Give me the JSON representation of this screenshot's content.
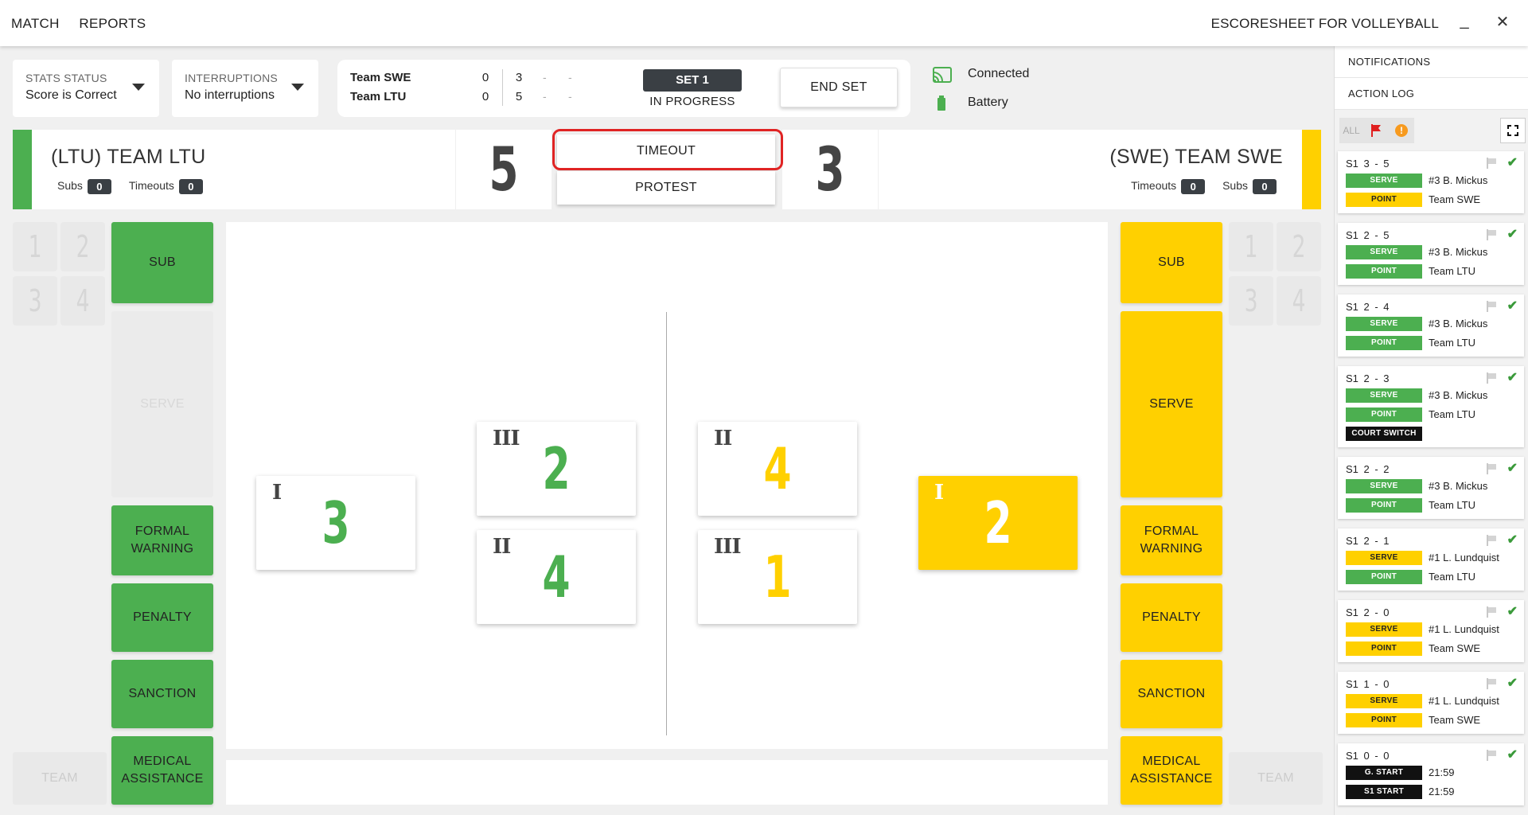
{
  "topbar": {
    "nav": [
      "MATCH",
      "REPORTS"
    ],
    "app_title": "ESCORESHEET FOR VOLLEYBALL",
    "minimize": "_",
    "close": "✕"
  },
  "status": {
    "stats_label": "STATS STATUS",
    "stats_value": "Score is Correct",
    "interruptions_label": "INTERRUPTIONS",
    "interruptions_value": "No interruptions"
  },
  "scoreboard": {
    "teams": [
      {
        "name": "Team SWE",
        "sets": "0",
        "s1": "3",
        "s2": "-",
        "s3": "-"
      },
      {
        "name": "Team LTU",
        "sets": "0",
        "s1": "5",
        "s2": "-",
        "s3": "-"
      }
    ],
    "set_label": "SET 1",
    "set_state": "IN PROGRESS",
    "end_set": "END SET"
  },
  "connection": {
    "connected": "Connected",
    "battery": "Battery",
    "connected_color": "#4caf50",
    "battery_color": "#4caf50"
  },
  "home": {
    "name": "(LTU) TEAM LTU",
    "subs_label": "Subs",
    "subs": "0",
    "timeouts_label": "Timeouts",
    "timeouts": "0",
    "score": "5",
    "color": "#4caf50"
  },
  "away": {
    "name": "(SWE) TEAM SWE",
    "subs_label": "Subs",
    "subs": "0",
    "timeouts_label": "Timeouts",
    "timeouts": "0",
    "score": "3",
    "color": "#ffd000"
  },
  "center": {
    "timeout": "TIMEOUT",
    "protest": "PROTEST"
  },
  "actions": {
    "sub": "SUB",
    "serve": "SERVE",
    "formal_warning_1": "FORMAL",
    "formal_warning_2": "WARNING",
    "penalty": "PENALTY",
    "sanction": "SANCTION",
    "medical_1": "MEDICAL",
    "medical_2": "ASSISTANCE",
    "team": "TEAM"
  },
  "slots": [
    "1",
    "2",
    "3",
    "4"
  ],
  "court": {
    "home": [
      {
        "pos": "I",
        "num": "3"
      },
      {
        "pos": "III",
        "num": "2"
      },
      {
        "pos": "II",
        "num": "4"
      }
    ],
    "away": [
      {
        "pos": "II",
        "num": "4"
      },
      {
        "pos": "III",
        "num": "1"
      },
      {
        "pos": "I",
        "num": "2"
      }
    ]
  },
  "panel": {
    "notifications": "NOTIFICATIONS",
    "action_log": "ACTION LOG",
    "filter_all": "ALL",
    "warning_glyph": "!"
  },
  "log": [
    {
      "head": "S1 3 - 5",
      "rows": [
        {
          "tag": "SERVE",
          "c": "green",
          "t": "#3 B. Mickus"
        },
        {
          "tag": "POINT",
          "c": "yellow",
          "t": "Team SWE"
        }
      ]
    },
    {
      "head": "S1 2 - 5",
      "rows": [
        {
          "tag": "SERVE",
          "c": "green",
          "t": "#3 B. Mickus"
        },
        {
          "tag": "POINT",
          "c": "green",
          "t": "Team LTU"
        }
      ]
    },
    {
      "head": "S1 2 - 4",
      "rows": [
        {
          "tag": "SERVE",
          "c": "green",
          "t": "#3 B. Mickus"
        },
        {
          "tag": "POINT",
          "c": "green",
          "t": "Team LTU"
        }
      ]
    },
    {
      "head": "S1 2 - 3",
      "rows": [
        {
          "tag": "SERVE",
          "c": "green",
          "t": "#3 B. Mickus"
        },
        {
          "tag": "POINT",
          "c": "green",
          "t": "Team LTU"
        },
        {
          "tag": "COURT SWITCH",
          "c": "black",
          "t": ""
        }
      ]
    },
    {
      "head": "S1 2 - 2",
      "rows": [
        {
          "tag": "SERVE",
          "c": "green",
          "t": "#3 B. Mickus"
        },
        {
          "tag": "POINT",
          "c": "green",
          "t": "Team LTU"
        }
      ]
    },
    {
      "head": "S1 2 - 1",
      "rows": [
        {
          "tag": "SERVE",
          "c": "yellow",
          "t": "#1 L. Lundquist"
        },
        {
          "tag": "POINT",
          "c": "green",
          "t": "Team LTU"
        }
      ]
    },
    {
      "head": "S1 2 - 0",
      "rows": [
        {
          "tag": "SERVE",
          "c": "yellow",
          "t": "#1 L. Lundquist"
        },
        {
          "tag": "POINT",
          "c": "yellow",
          "t": "Team SWE"
        }
      ]
    },
    {
      "head": "S1 1 - 0",
      "rows": [
        {
          "tag": "SERVE",
          "c": "yellow",
          "t": "#1 L. Lundquist"
        },
        {
          "tag": "POINT",
          "c": "yellow",
          "t": "Team SWE"
        }
      ]
    },
    {
      "head": "S1 0 - 0",
      "rows": [
        {
          "tag": "G. START",
          "c": "black",
          "t": "21:59"
        },
        {
          "tag": "S1 START",
          "c": "black",
          "t": "21:59"
        }
      ]
    }
  ]
}
